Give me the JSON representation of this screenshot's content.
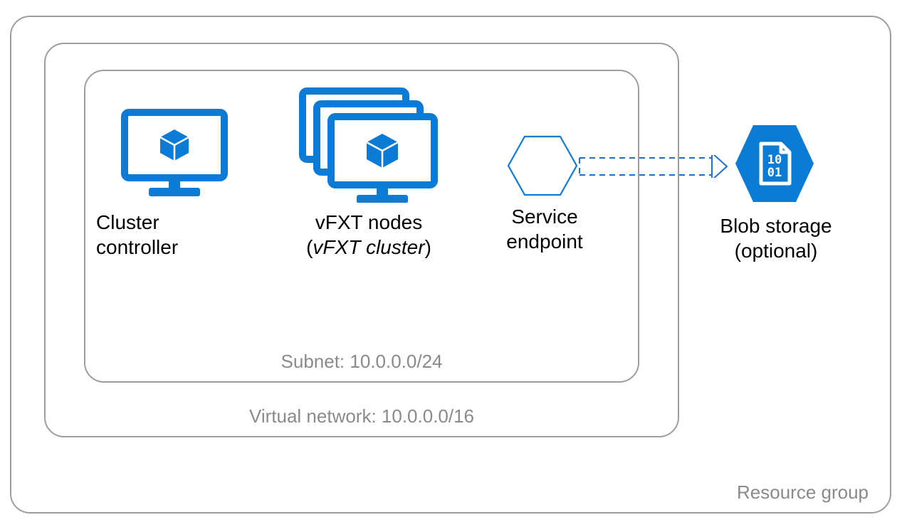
{
  "colors": {
    "accent": "#0b7bd6",
    "gray": "#9e9e9e",
    "white": "#ffffff"
  },
  "labels": {
    "resource_group": "Resource group",
    "vnet": "Virtual network: 10.0.0.0/16",
    "subnet": "Subnet: 10.0.0.0/24",
    "cluster_controller_l1": "Cluster",
    "cluster_controller_l2": "controller",
    "vfxt_l1": "vFXT nodes",
    "vfxt_l2_prefix": "(",
    "vfxt_l2_italic": "vFXT cluster",
    "vfxt_l2_suffix": ")",
    "service_endpoint_l1": "Service",
    "service_endpoint_l2": "endpoint",
    "blob_l1": "Blob storage",
    "blob_l2": "(optional)"
  }
}
